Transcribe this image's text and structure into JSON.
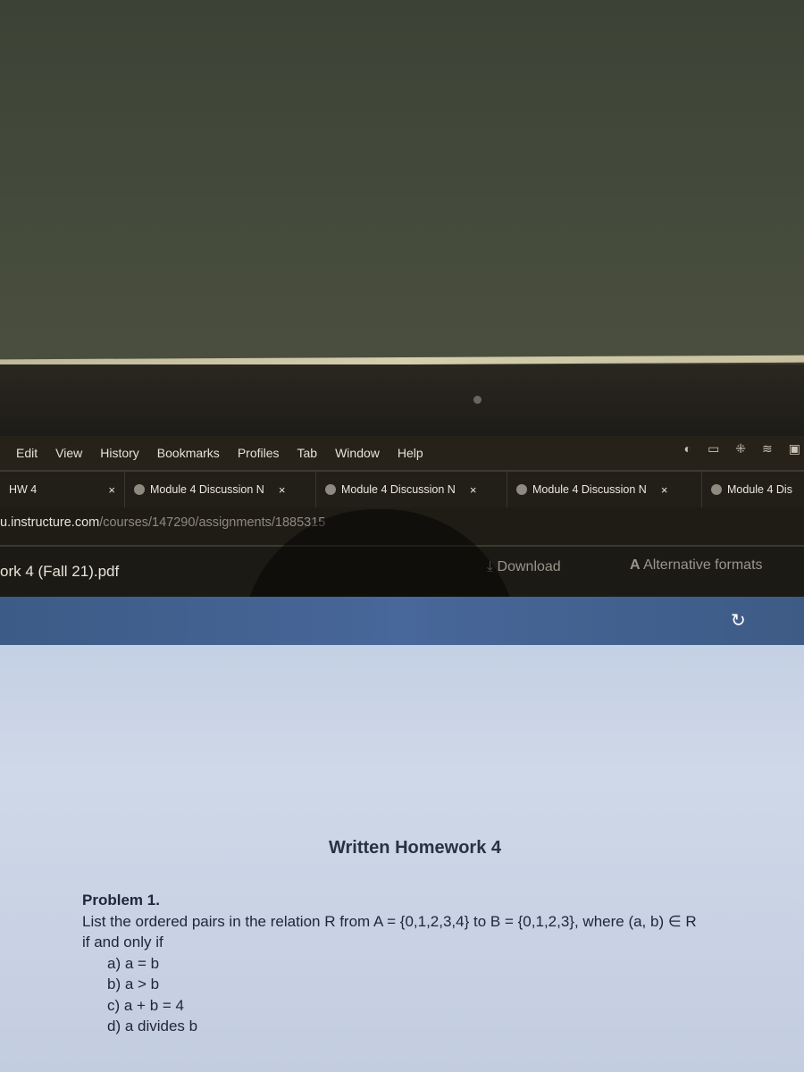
{
  "menu": [
    "Edit",
    "View",
    "History",
    "Bookmarks",
    "Profiles",
    "Tab",
    "Window",
    "Help"
  ],
  "tabs": [
    {
      "label": "HW 4"
    },
    {
      "label": "Module 4 Discussion N"
    },
    {
      "label": "Module 4 Discussion N"
    },
    {
      "label": "Module 4 Discussion N"
    },
    {
      "label": "Module 4 Dis"
    }
  ],
  "tab_close": "×",
  "url": {
    "host": "u.instructure.com",
    "path": "/courses/147290/assignments/1885315"
  },
  "toolbar": {
    "filename": "ork 4 (Fall 21).pdf",
    "download": "Download",
    "alternative": "Alternative formats"
  },
  "document": {
    "title": "Written Homework 4",
    "problem_heading": "Problem 1.",
    "problem_text": "List the ordered pairs in the relation R from A = {0,1,2,3,4} to B = {0,1,2,3}, where (a, b) ∈ R",
    "problem_text2": "if and only if",
    "items": [
      "a)  a = b",
      "b)  a > b",
      "c)  a + b = 4",
      "d)  a divides b"
    ]
  }
}
